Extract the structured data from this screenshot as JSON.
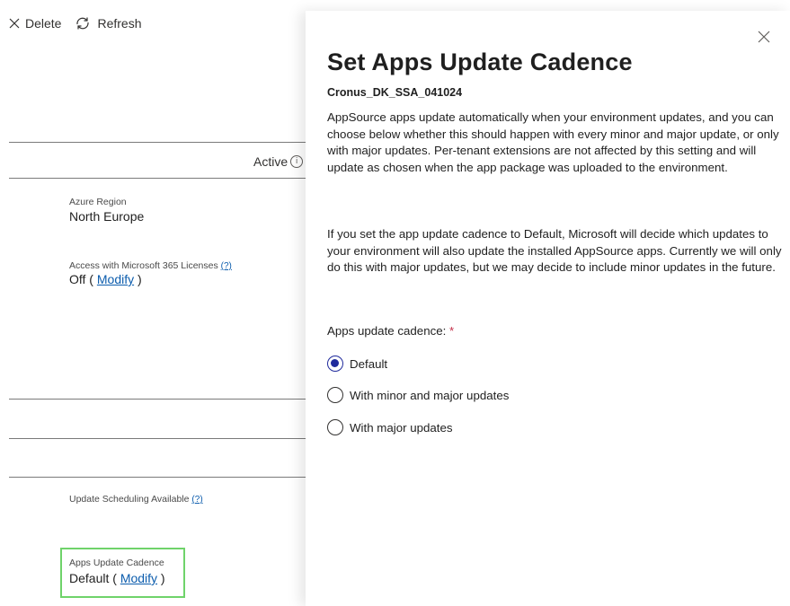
{
  "toolbar": {
    "delete_label": "Delete",
    "refresh_label": "Refresh"
  },
  "list": {
    "active_label": "Active"
  },
  "details": {
    "azure_region_label": "Azure Region",
    "azure_region_value": "North Europe",
    "m365_label": "Access with Microsoft 365 Licenses",
    "m365_help": "(?)",
    "m365_value": "Off",
    "m365_modify": "Modify",
    "scheduling_label": "Update Scheduling Available",
    "scheduling_help": "(?)",
    "cadence_label": "Apps Update Cadence",
    "cadence_value": "Default",
    "cadence_modify": "Modify"
  },
  "panel": {
    "title": "Set Apps Update Cadence",
    "environment_name": "Cronus_DK_SSA_041024",
    "paragraph1": "AppSource apps update automatically when your environment updates, and you can choose below whether this should happen with every minor and major update, or only with major updates. Per-tenant extensions are not affected by this setting and will update as chosen when the app package was uploaded to the environment.",
    "paragraph2": "If you set the app update cadence to Default, Microsoft will decide which updates to your environment will also update the installed AppSource apps. Currently we will only do this with major updates, but we may decide to include minor updates in the future.",
    "cadence_label": "Apps update cadence:",
    "required_marker": "*",
    "options": [
      {
        "label": "Default",
        "selected": true
      },
      {
        "label": "With minor and major updates",
        "selected": false
      },
      {
        "label": "With major updates",
        "selected": false
      }
    ]
  },
  "colors": {
    "accent": "#1f2a9c",
    "link": "#0b5cad",
    "highlight": "#6fd36a",
    "required": "#c4314b"
  }
}
